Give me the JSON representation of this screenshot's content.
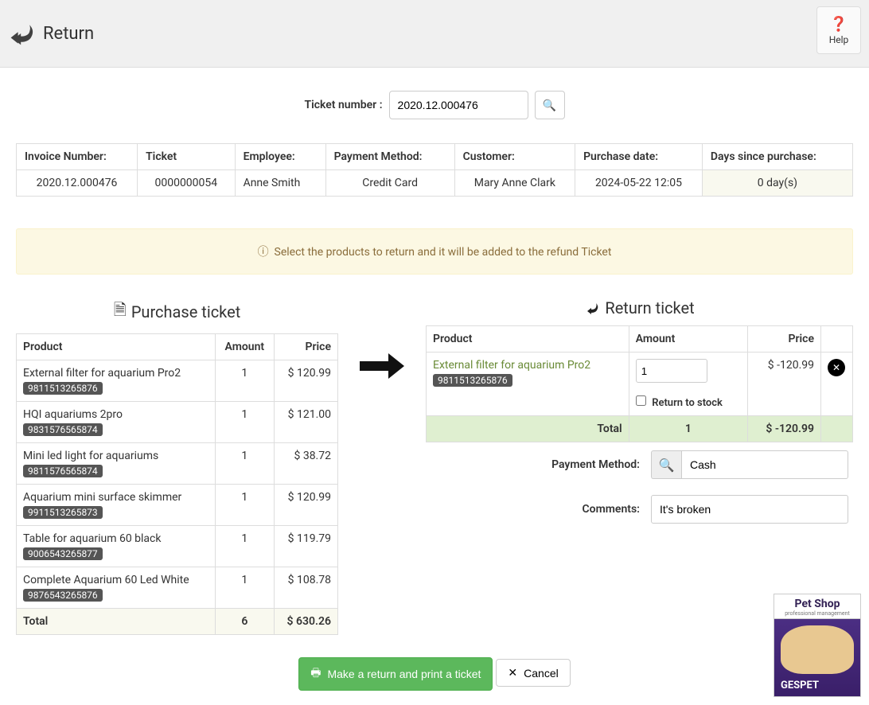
{
  "header": {
    "title": "Return",
    "help": "Help"
  },
  "search": {
    "label": "Ticket number :",
    "value": "2020.12.000476"
  },
  "summary": {
    "headers": {
      "invoice": "Invoice Number:",
      "ticket": "Ticket",
      "employee": "Employee:",
      "payment": "Payment Method:",
      "customer": "Customer:",
      "date": "Purchase date:",
      "days": "Days since purchase:"
    },
    "row": {
      "invoice": "2020.12.000476",
      "ticket": "0000000054",
      "employee": "Anne Smith",
      "payment": "Credit Card",
      "customer": "Mary Anne Clark",
      "date": "2024-05-22 12:05",
      "days": "0 day(s)"
    }
  },
  "info": "Select the products to return and it will be added to the refund Ticket",
  "purchase": {
    "title": "Purchase ticket",
    "cols": {
      "product": "Product",
      "amount": "Amount",
      "price": "Price"
    },
    "items": [
      {
        "name": "External filter for aquarium Pro2",
        "sku": "9811513265876",
        "amount": "1",
        "price": "$ 120.99"
      },
      {
        "name": "HQI aquariums 2pro",
        "sku": "9831576565874",
        "amount": "1",
        "price": "$ 121.00"
      },
      {
        "name": "Mini led light for aquariums",
        "sku": "9811576565874",
        "amount": "1",
        "price": "$ 38.72"
      },
      {
        "name": "Aquarium mini surface skimmer",
        "sku": "9911513265873",
        "amount": "1",
        "price": "$ 120.99"
      },
      {
        "name": "Table for aquarium 60 black",
        "sku": "9006543265877",
        "amount": "1",
        "price": "$ 119.79"
      },
      {
        "name": "Complete Aquarium 60 Led White",
        "sku": "9876543265876",
        "amount": "1",
        "price": "$ 108.78"
      }
    ],
    "total_label": "Total",
    "total_amount": "6",
    "total_price": "$ 630.26"
  },
  "return": {
    "title": "Return ticket",
    "cols": {
      "product": "Product",
      "amount": "Amount",
      "price": "Price"
    },
    "item": {
      "name": "External filter for aquarium Pro2",
      "sku": "9811513265876",
      "qty": "1",
      "price": "$ -120.99",
      "stock_label": "Return to stock"
    },
    "total_label": "Total",
    "total_qty": "1",
    "total_price": "$ -120.99",
    "payment_label": "Payment Method:",
    "payment_value": "Cash",
    "comments_label": "Comments:",
    "comments_value": "It's broken"
  },
  "actions": {
    "submit": "Make a return and print a ticket",
    "cancel": "Cancel"
  },
  "brand": {
    "title": "Pet Shop",
    "subtitle": "professional management",
    "logo": "GESPET"
  }
}
